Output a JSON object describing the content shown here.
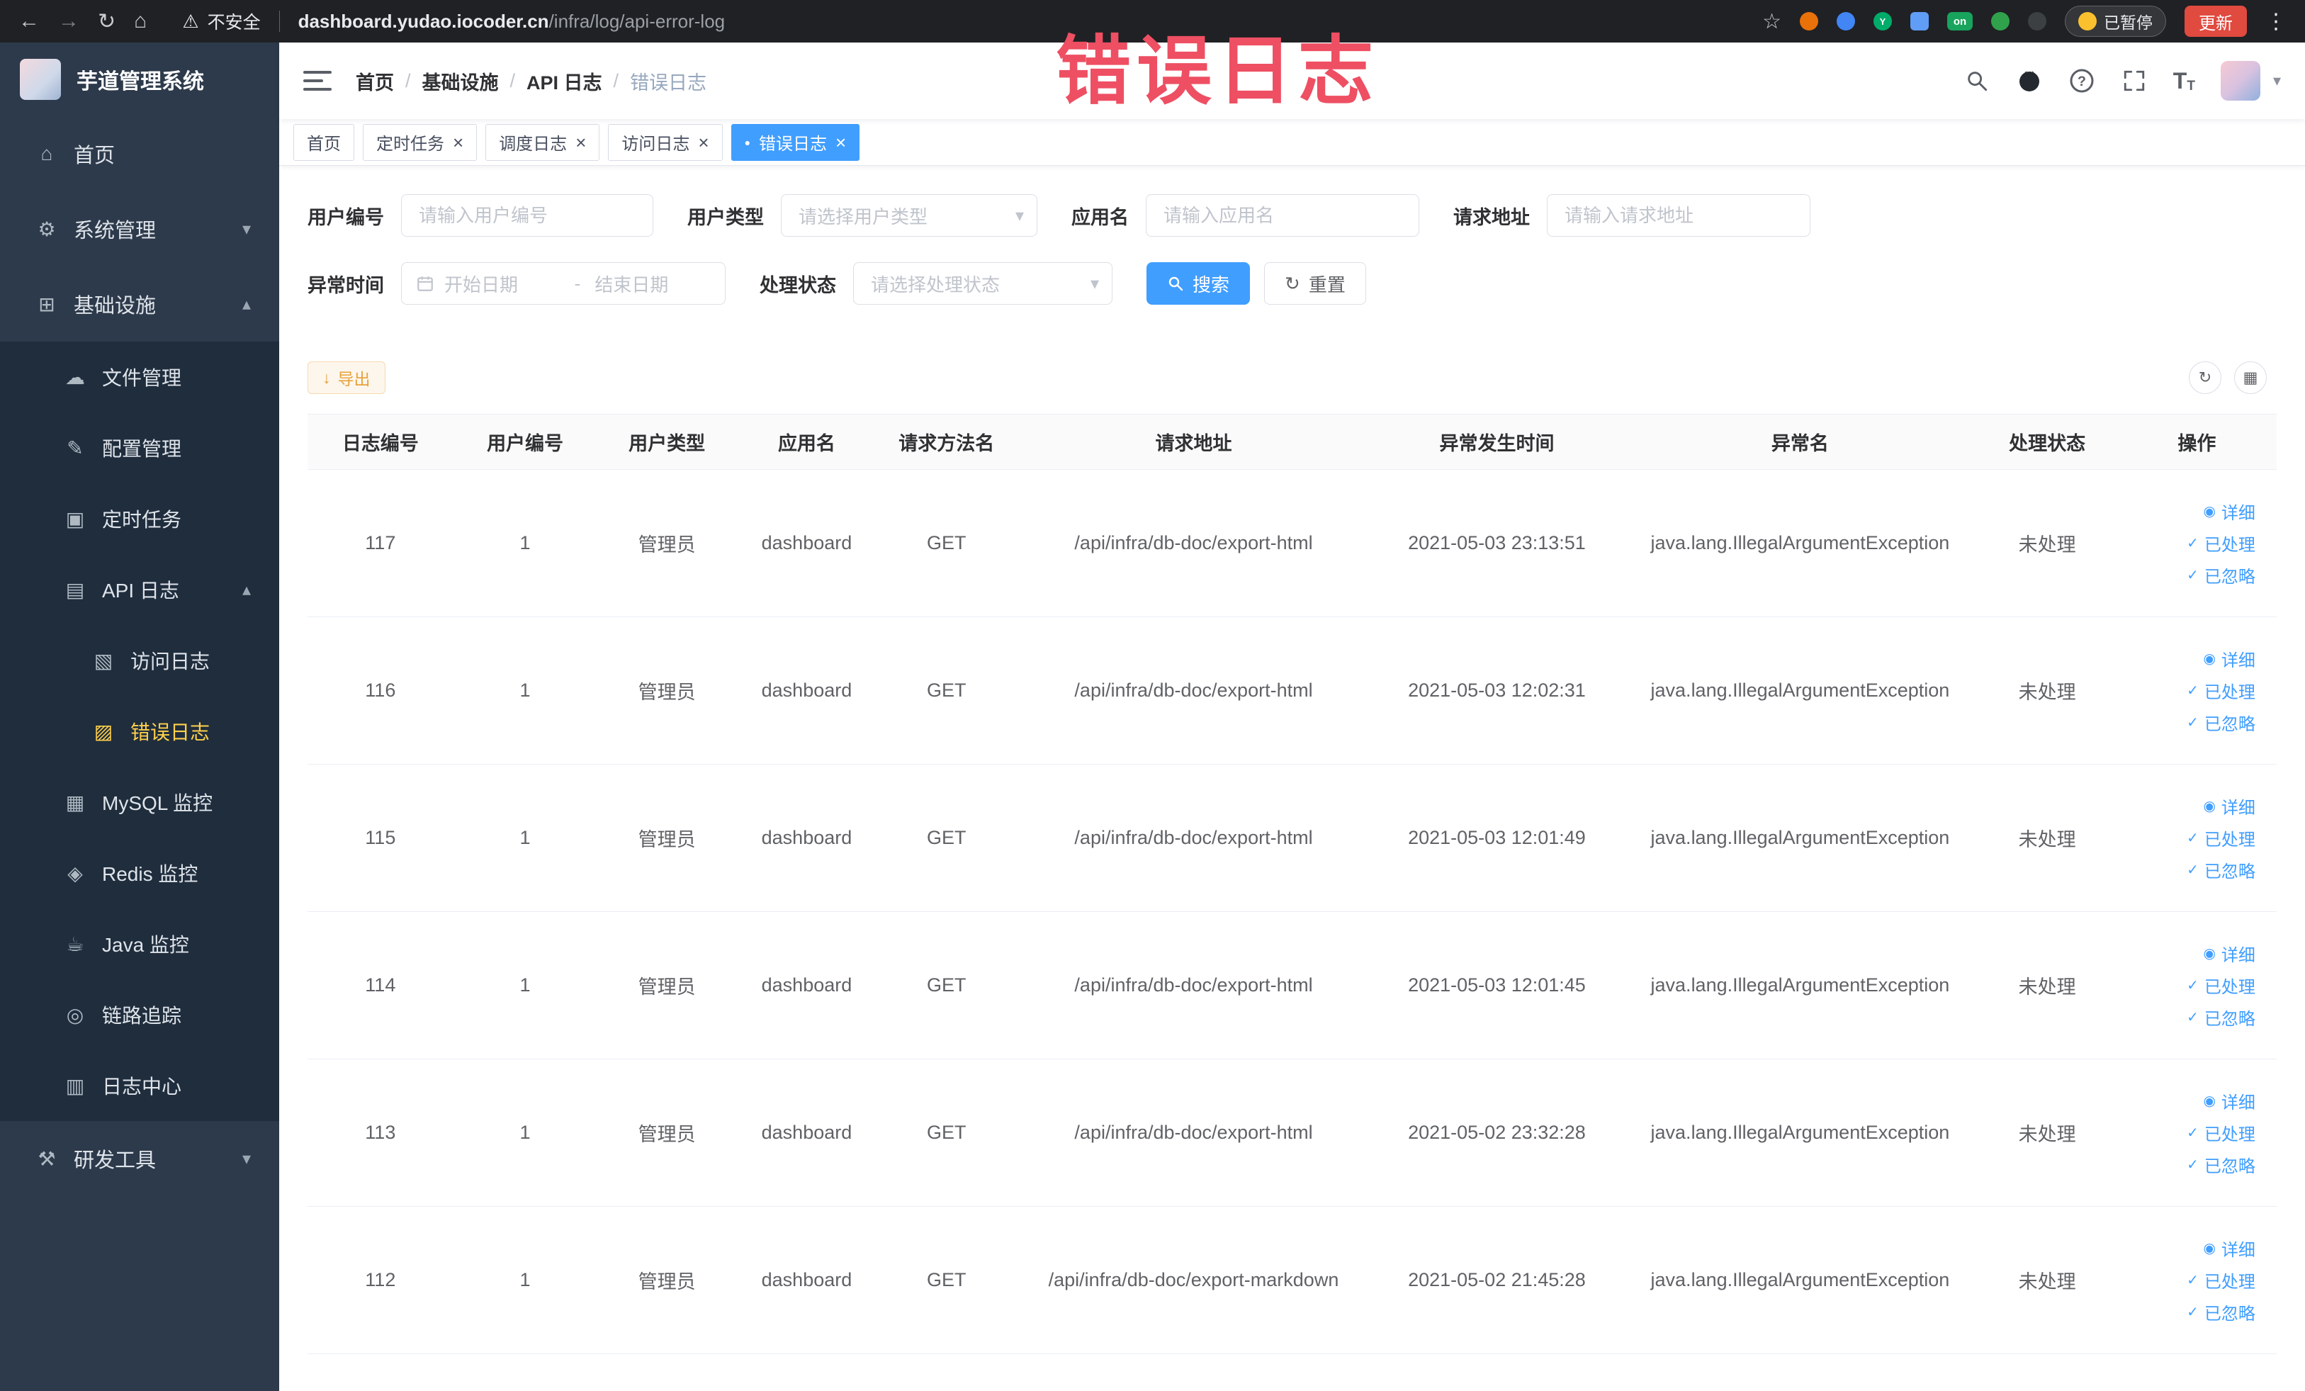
{
  "annotation": {
    "text": "错误日志",
    "color": "#ee4f63"
  },
  "browser": {
    "security_label": "不安全",
    "url_domain": "dashboard.yudao.iocoder.cn",
    "url_path": "/infra/log/api-error-log",
    "paused_badge": "已暂停",
    "update_button": "更新"
  },
  "icons": {
    "back": "←",
    "forward": "→",
    "reload": "↻",
    "home_nav": "⌂",
    "warning": "⚠",
    "star": "☆",
    "overflow": "⋮",
    "home": "⌂",
    "system": "⚙",
    "infra": "⊞",
    "file": "☁",
    "config": "✎",
    "job": "▣",
    "apilog": "▤",
    "accesslog": "▧",
    "errorlog": "▨",
    "mysql": "▦",
    "redis": "◈",
    "java": "☕",
    "trace": "◎",
    "logcenter": "▥",
    "tools": "⚒",
    "chevron_down": "▾",
    "chevron_up": "▴",
    "close": "×",
    "active_dot": "●",
    "caret_down": "▾",
    "eye": "◉",
    "check": "✓",
    "download": "↓",
    "refresh": "↻",
    "columns": "▦"
  },
  "sidebar": {
    "logo_title": "芋道管理系统",
    "items": [
      {
        "label": "首页",
        "level": 1
      },
      {
        "label": "系统管理",
        "level": 1
      },
      {
        "label": "基础设施",
        "level": 1
      },
      {
        "label": "文件管理",
        "level": 2
      },
      {
        "label": "配置管理",
        "level": 2
      },
      {
        "label": "定时任务",
        "level": 2
      },
      {
        "label": "API 日志",
        "level": 2
      },
      {
        "label": "访问日志",
        "level": 3
      },
      {
        "label": "错误日志",
        "level": 3,
        "active": true
      },
      {
        "label": "MySQL 监控",
        "level": 2
      },
      {
        "label": "Redis 监控",
        "level": 2
      },
      {
        "label": "Java 监控",
        "level": 2
      },
      {
        "label": "链路追踪",
        "level": 2
      },
      {
        "label": "日志中心",
        "level": 2
      },
      {
        "label": "研发工具",
        "level": 1
      }
    ]
  },
  "breadcrumb": {
    "separator": "/",
    "items": [
      "首页",
      "基础设施",
      "API 日志",
      "错误日志"
    ]
  },
  "tabs": [
    {
      "label": "首页"
    },
    {
      "label": "定时任务",
      "closable": true
    },
    {
      "label": "调度日志",
      "closable": true
    },
    {
      "label": "访问日志",
      "closable": true
    },
    {
      "label": "错误日志",
      "closable": true,
      "active": true
    }
  ],
  "filters": {
    "user_id": {
      "label": "用户编号",
      "placeholder": "请输入用户编号"
    },
    "user_type": {
      "label": "用户类型",
      "placeholder": "请选择用户类型"
    },
    "app_name": {
      "label": "应用名",
      "placeholder": "请输入应用名"
    },
    "request_url": {
      "label": "请求地址",
      "placeholder": "请输入请求地址"
    },
    "exception_time": {
      "label": "异常时间",
      "start_placeholder": "开始日期",
      "separator": "-",
      "end_placeholder": "结束日期"
    },
    "process_status": {
      "label": "处理状态",
      "placeholder": "请选择处理状态"
    },
    "search_button": "搜索",
    "reset_button": "重置"
  },
  "toolbar": {
    "export_button": "导出"
  },
  "table": {
    "columns": [
      "日志编号",
      "用户编号",
      "用户类型",
      "应用名",
      "请求方法名",
      "请求地址",
      "异常发生时间",
      "异常名",
      "处理状态",
      "操作"
    ],
    "actions": {
      "detail": "详细",
      "processed": "已处理",
      "ignored": "已忽略"
    },
    "rows": [
      {
        "id": "117",
        "user_id": "1",
        "user_type": "管理员",
        "app": "dashboard",
        "method": "GET",
        "url": "/api/infra/db-doc/export-html",
        "time": "2021-05-03 23:13:51",
        "exception": "java.lang.IllegalArgumentException",
        "status": "未处理"
      },
      {
        "id": "116",
        "user_id": "1",
        "user_type": "管理员",
        "app": "dashboard",
        "method": "GET",
        "url": "/api/infra/db-doc/export-html",
        "time": "2021-05-03 12:02:31",
        "exception": "java.lang.IllegalArgumentException",
        "status": "未处理"
      },
      {
        "id": "115",
        "user_id": "1",
        "user_type": "管理员",
        "app": "dashboard",
        "method": "GET",
        "url": "/api/infra/db-doc/export-html",
        "time": "2021-05-03 12:01:49",
        "exception": "java.lang.IllegalArgumentException",
        "status": "未处理"
      },
      {
        "id": "114",
        "user_id": "1",
        "user_type": "管理员",
        "app": "dashboard",
        "method": "GET",
        "url": "/api/infra/db-doc/export-html",
        "time": "2021-05-03 12:01:45",
        "exception": "java.lang.IllegalArgumentException",
        "status": "未处理"
      },
      {
        "id": "113",
        "user_id": "1",
        "user_type": "管理员",
        "app": "dashboard",
        "method": "GET",
        "url": "/api/infra/db-doc/export-html",
        "time": "2021-05-02 23:32:28",
        "exception": "java.lang.IllegalArgumentException",
        "status": "未处理"
      },
      {
        "id": "112",
        "user_id": "1",
        "user_type": "管理员",
        "app": "dashboard",
        "method": "GET",
        "url": "/api/infra/db-doc/export-markdown",
        "time": "2021-05-02 21:45:28",
        "exception": "java.lang.IllegalArgumentException",
        "status": "未处理"
      }
    ]
  }
}
